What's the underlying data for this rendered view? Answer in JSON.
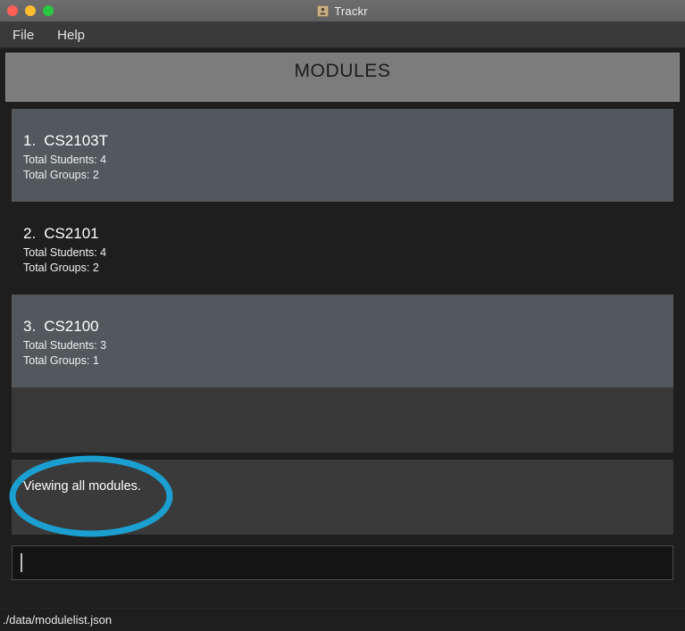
{
  "window": {
    "title": "Trackr",
    "icon": "person-icon",
    "controls": {
      "close_label": "close",
      "minimize_label": "minimize",
      "maximize_label": "maximize",
      "close_color": "#ff5f57",
      "minimize_color": "#febc2e",
      "maximize_color": "#28c840"
    }
  },
  "menubar": {
    "items": [
      {
        "label": "File"
      },
      {
        "label": "Help"
      }
    ]
  },
  "header": {
    "title": "MODULES"
  },
  "modules": {
    "items": [
      {
        "index": "1.",
        "code": "CS2103T",
        "students_label": "Total Students: 4",
        "groups_label": "Total Groups: 2"
      },
      {
        "index": "2.",
        "code": "CS2101",
        "students_label": "Total Students: 4",
        "groups_label": "Total Groups: 2"
      },
      {
        "index": "3.",
        "code": "CS2100",
        "students_label": "Total Students: 3",
        "groups_label": "Total Groups: 1"
      }
    ]
  },
  "result": {
    "message": "Viewing all modules."
  },
  "command": {
    "value": "",
    "placeholder": ""
  },
  "status": {
    "path": "./data/modulelist.json"
  },
  "annotation": {
    "shape": "ellipse",
    "color": "#1b9fd1",
    "targets": "result.message"
  }
}
